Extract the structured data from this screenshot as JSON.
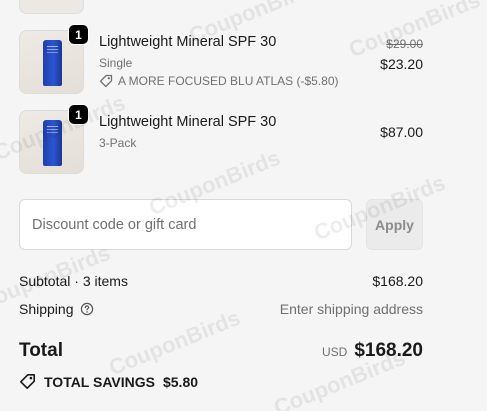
{
  "watermark_text": "CouponBirds",
  "items": [
    {
      "quantity": "1",
      "title": "Lightweight Mineral SPF 30",
      "variant": "Single",
      "discount_label": "A MORE FOCUSED BLU ATLAS (-$5.80)",
      "original_price": "$29.00",
      "price": "$23.20"
    },
    {
      "quantity": "1",
      "title": "Lightweight Mineral SPF 30",
      "variant": "3-Pack",
      "price": "$87.00"
    }
  ],
  "discount": {
    "placeholder": "Discount code or gift card",
    "apply_label": "Apply"
  },
  "summary": {
    "subtotal_label": "Subtotal · 3 items",
    "subtotal_value": "$168.20",
    "shipping_label": "Shipping",
    "shipping_value": "Enter shipping address",
    "total_label": "Total",
    "currency": "USD",
    "total_value": "$168.20",
    "savings_label": "TOTAL SAVINGS",
    "savings_value": "$5.80"
  },
  "colors": {
    "background": "#f5f5f5",
    "badge": "#000000",
    "product_tube": "#2d55d1",
    "muted_text": "#707070"
  },
  "icons": [
    "tag-icon",
    "help-circle-icon",
    "savings-tag-icon"
  ]
}
